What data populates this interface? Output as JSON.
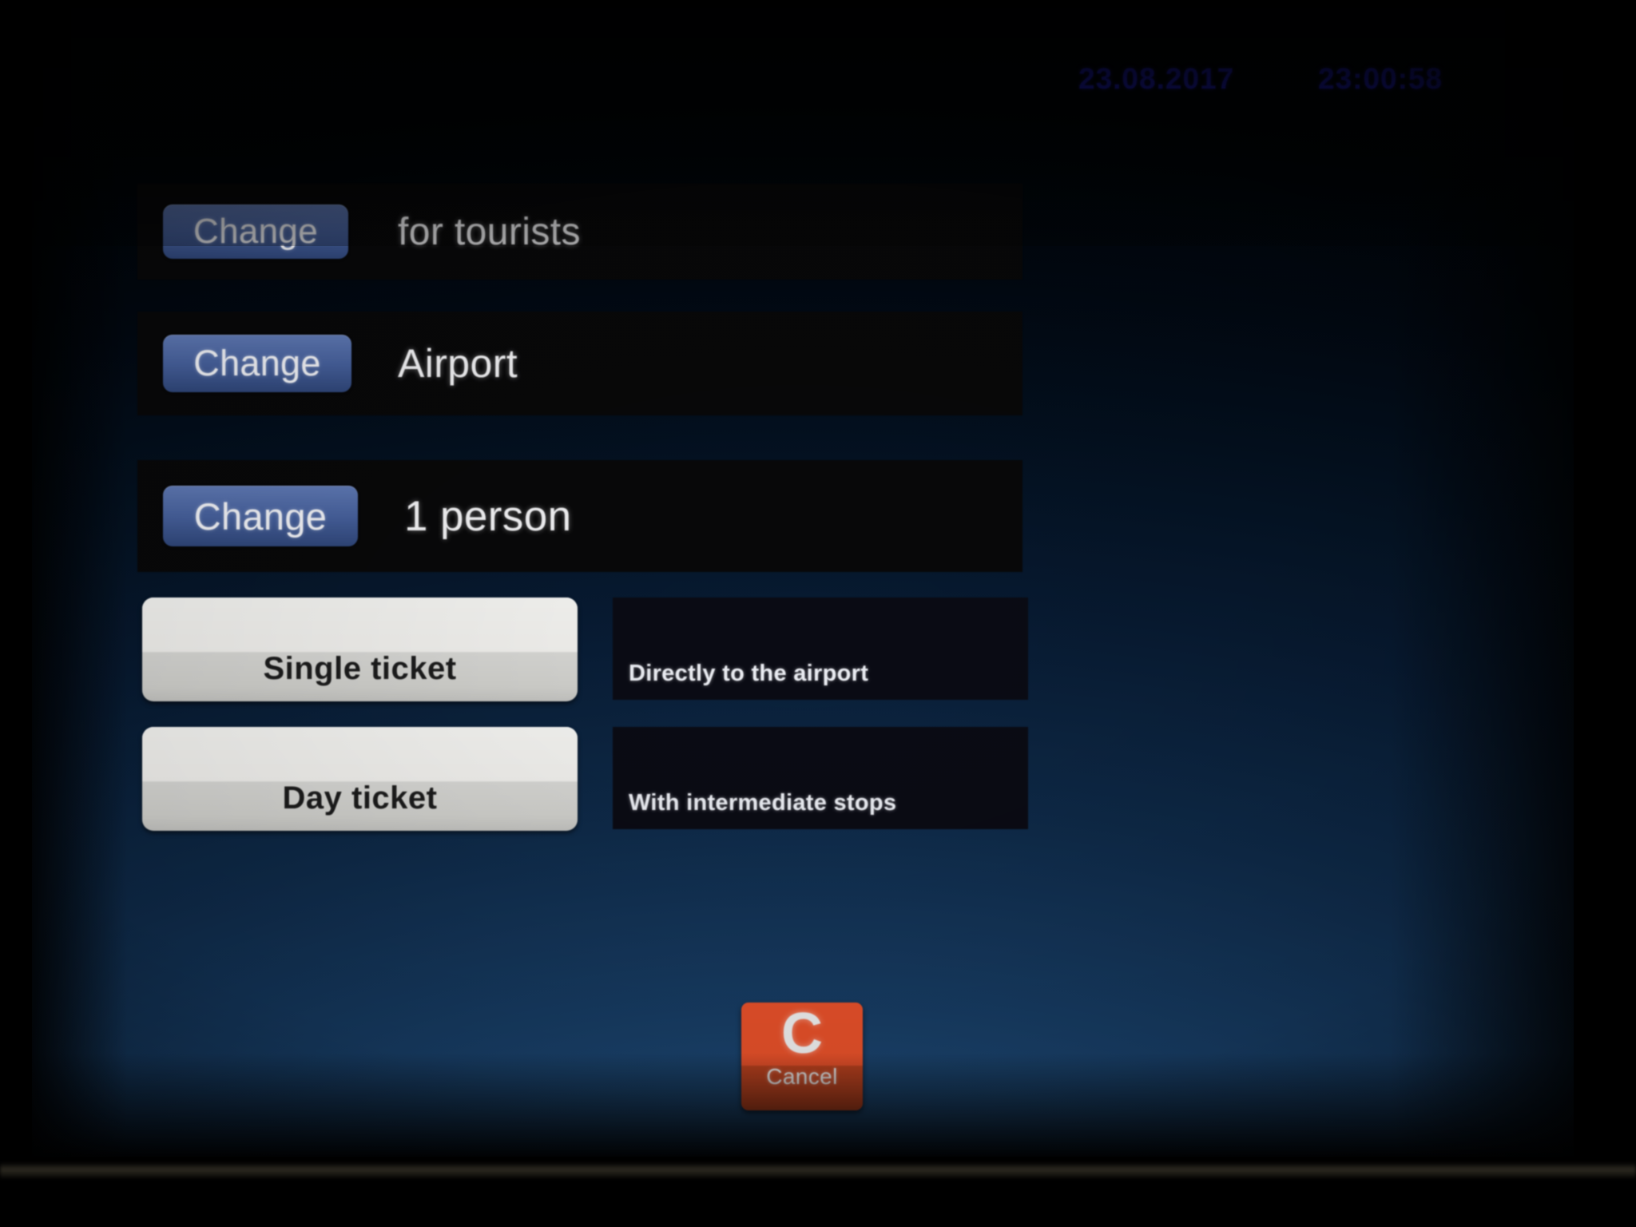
{
  "status_bar": {
    "date": "23.08.2017",
    "time": "23:00:58"
  },
  "summary": {
    "rows": [
      {
        "change_label": "Change",
        "value": "for tourists",
        "name": "category"
      },
      {
        "change_label": "Change",
        "value": "Airport",
        "name": "destination"
      },
      {
        "change_label": "Change",
        "value": "1 person",
        "name": "persons"
      }
    ]
  },
  "options": {
    "tickets": [
      {
        "label": "Single ticket",
        "description": "Directly to the airport"
      },
      {
        "label": "Day ticket",
        "description": "With intermediate stops"
      }
    ]
  },
  "cancel": {
    "glyph": "C",
    "label": "Cancel"
  },
  "colors": {
    "screen_blue": "#21507e",
    "change_button_blue": "#46609c",
    "ticket_button_gray": "#f0efec",
    "cancel_orange": "#e8512a",
    "status_text_blue": "#2222dd",
    "panel_black": "#080809"
  }
}
